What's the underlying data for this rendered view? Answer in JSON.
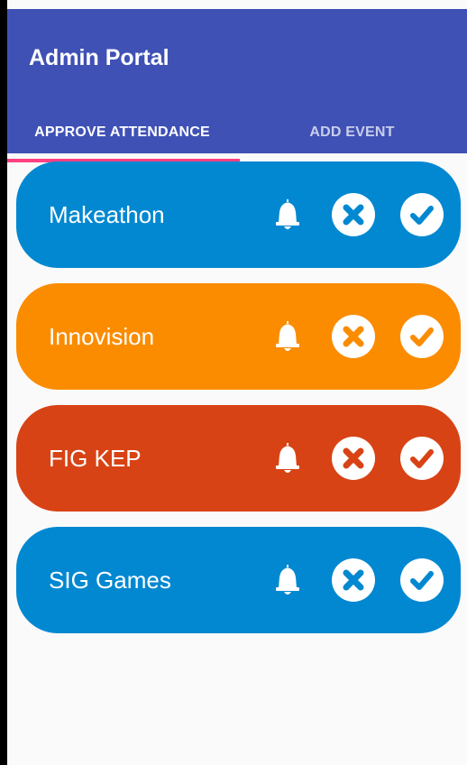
{
  "app": {
    "title": "Admin Portal",
    "colors": {
      "primary": "#3f51b5",
      "tab_indicator": "#ff4081",
      "background": "#fafafa"
    }
  },
  "tabs": [
    {
      "label": "APPROVE ATTENDANCE",
      "selected": true
    },
    {
      "label": "ADD EVENT",
      "selected": false
    }
  ],
  "events": [
    {
      "name": "Makeathon",
      "color": "#0288d1",
      "icons": [
        "bell-icon",
        "close-circle-icon",
        "check-circle-icon"
      ]
    },
    {
      "name": "Innovision",
      "color": "#fb8c00",
      "icons": [
        "bell-icon",
        "close-circle-icon",
        "check-circle-icon"
      ]
    },
    {
      "name": "FIG KEP",
      "color": "#d84315",
      "icons": [
        "bell-icon",
        "close-circle-icon",
        "check-circle-icon"
      ]
    },
    {
      "name": "SIG Games",
      "color": "#0288d1",
      "icons": [
        "bell-icon",
        "close-circle-icon",
        "check-circle-icon"
      ]
    }
  ]
}
